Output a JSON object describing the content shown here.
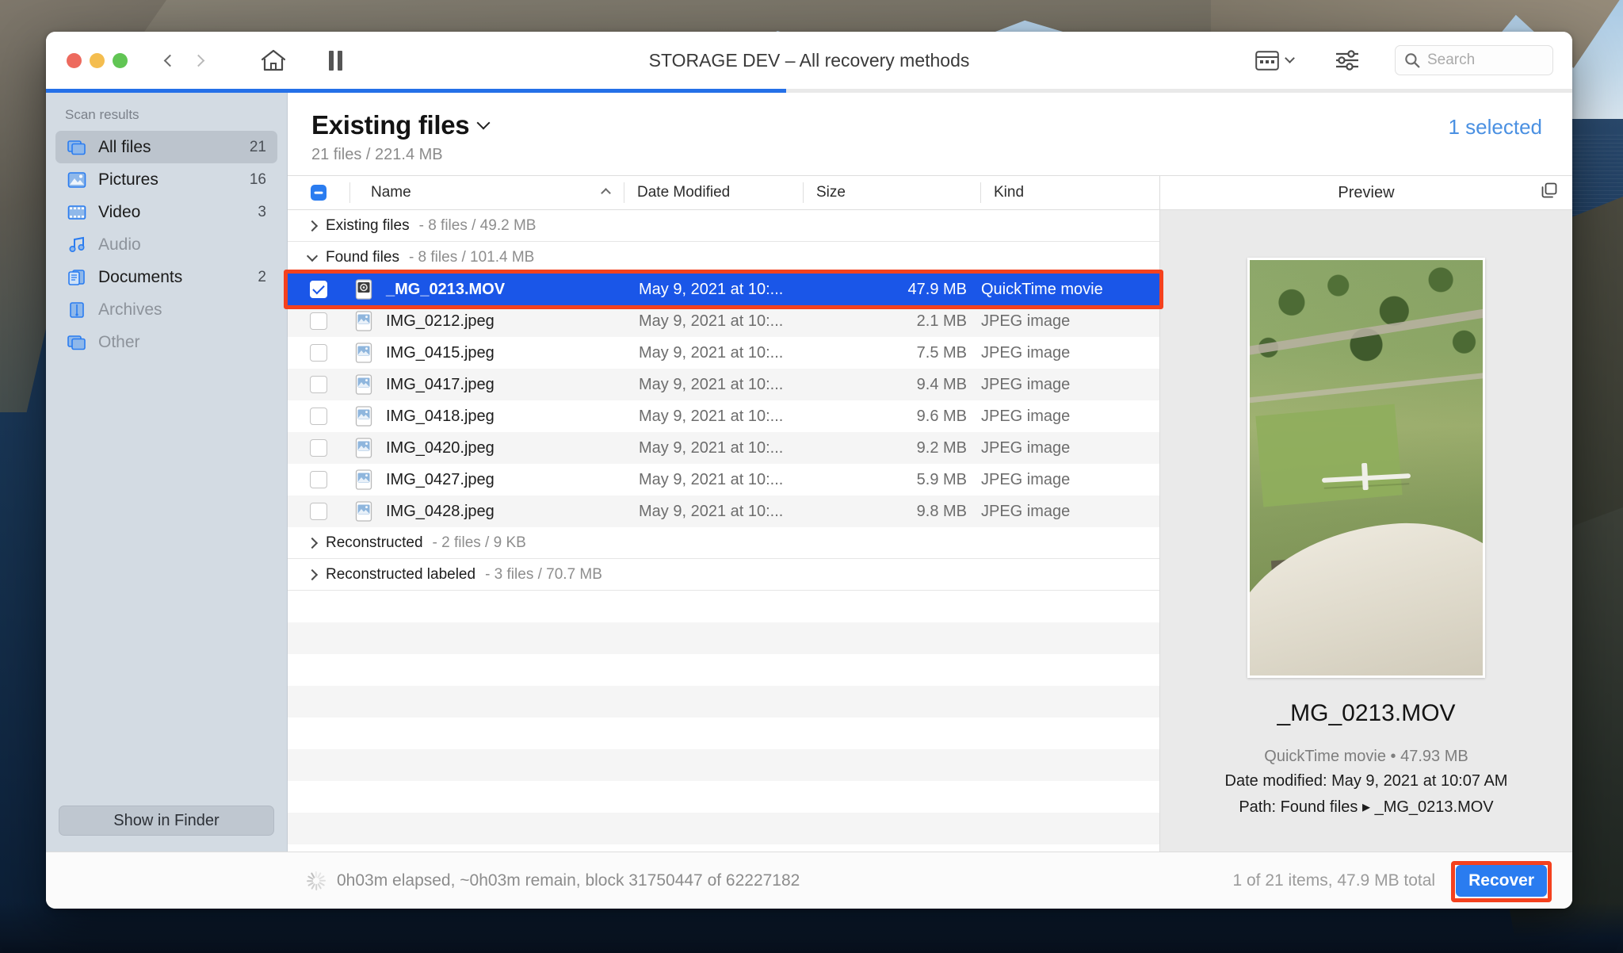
{
  "window": {
    "title": "STORAGE DEV – All recovery methods",
    "traffic_lights": [
      "close",
      "minimize",
      "zoom"
    ],
    "nav_back": "back",
    "nav_forward": "forward",
    "home": "home",
    "pause": "pause"
  },
  "toolbar": {
    "view_mode": "view-mode",
    "filter": "filter",
    "search_placeholder": "Search",
    "search_value": ""
  },
  "progress": {
    "percent": 48.5
  },
  "sidebar": {
    "title": "Scan results",
    "items": [
      {
        "label": "All files",
        "count": "21",
        "icon": "files-icon",
        "active": true,
        "dim": false
      },
      {
        "label": "Pictures",
        "count": "16",
        "icon": "picture-icon",
        "active": false,
        "dim": false
      },
      {
        "label": "Video",
        "count": "3",
        "icon": "film-icon",
        "active": false,
        "dim": false
      },
      {
        "label": "Audio",
        "count": "",
        "icon": "music-icon",
        "active": false,
        "dim": true
      },
      {
        "label": "Documents",
        "count": "2",
        "icon": "documents-icon",
        "active": false,
        "dim": false
      },
      {
        "label": "Archives",
        "count": "",
        "icon": "archive-icon",
        "active": false,
        "dim": true
      },
      {
        "label": "Other",
        "count": "",
        "icon": "files-icon",
        "active": false,
        "dim": true
      }
    ],
    "show_in_finder": "Show in Finder"
  },
  "main": {
    "heading": "Existing files",
    "subheading": "21 files / 221.4 MB",
    "selected_label": "1 selected",
    "columns": {
      "name": "Name",
      "date_modified": "Date Modified",
      "size": "Size",
      "kind": "Kind"
    },
    "rows": [
      {
        "type": "group",
        "label": "Existing files",
        "meta": "- 8 files / 49.2 MB",
        "expanded": false
      },
      {
        "type": "group",
        "label": "Found files",
        "meta": "- 8 files / 101.4 MB",
        "expanded": true
      },
      {
        "type": "file",
        "name": "_MG_0213.MOV",
        "date": "May 9, 2021 at 10:...",
        "size": "47.9 MB",
        "kind": "QuickTime movie",
        "icon": "movie-file-icon",
        "checked": true,
        "selected": true
      },
      {
        "type": "file",
        "name": "IMG_0212.jpeg",
        "date": "May 9, 2021 at 10:...",
        "size": "2.1 MB",
        "kind": "JPEG image",
        "icon": "jpeg-file-icon",
        "checked": false,
        "selected": false
      },
      {
        "type": "file",
        "name": "IMG_0415.jpeg",
        "date": "May 9, 2021 at 10:...",
        "size": "7.5 MB",
        "kind": "JPEG image",
        "icon": "jpeg-file-icon",
        "checked": false,
        "selected": false
      },
      {
        "type": "file",
        "name": "IMG_0417.jpeg",
        "date": "May 9, 2021 at 10:...",
        "size": "9.4 MB",
        "kind": "JPEG image",
        "icon": "jpeg-file-icon",
        "checked": false,
        "selected": false
      },
      {
        "type": "file",
        "name": "IMG_0418.jpeg",
        "date": "May 9, 2021 at 10:...",
        "size": "9.6 MB",
        "kind": "JPEG image",
        "icon": "jpeg-file-icon",
        "checked": false,
        "selected": false
      },
      {
        "type": "file",
        "name": "IMG_0420.jpeg",
        "date": "May 9, 2021 at 10:...",
        "size": "9.2 MB",
        "kind": "JPEG image",
        "icon": "jpeg-file-icon",
        "checked": false,
        "selected": false
      },
      {
        "type": "file",
        "name": "IMG_0427.jpeg",
        "date": "May 9, 2021 at 10:...",
        "size": "5.9 MB",
        "kind": "JPEG image",
        "icon": "jpeg-file-icon",
        "checked": false,
        "selected": false
      },
      {
        "type": "file",
        "name": "IMG_0428.jpeg",
        "date": "May 9, 2021 at 10:...",
        "size": "9.8 MB",
        "kind": "JPEG image",
        "icon": "jpeg-file-icon",
        "checked": false,
        "selected": false
      },
      {
        "type": "group",
        "label": "Reconstructed",
        "meta": "- 2 files / 9 KB",
        "expanded": false
      },
      {
        "type": "group",
        "label": "Reconstructed labeled",
        "meta": "- 3 files / 70.7 MB",
        "expanded": false
      }
    ]
  },
  "preview": {
    "header": "Preview",
    "filename": "_MG_0213.MOV",
    "kind_size": "QuickTime movie • 47.93 MB",
    "date_label": "Date modified:",
    "date_value": "May 9, 2021 at 10:07 AM",
    "path_label": "Path:",
    "path_value": "Found files ▸ _MG_0213.MOV"
  },
  "status": {
    "progress_text": "0h03m elapsed, ~0h03m remain, block 31750447 of 62227182",
    "items_text": "1 of 21 items, 47.9 MB total",
    "recover_label": "Recover"
  },
  "colors": {
    "accent_blue": "#2a7cf0",
    "selection_blue": "#1a56e8",
    "annotation_red": "#f4411e",
    "link_blue": "#4a90e2"
  }
}
